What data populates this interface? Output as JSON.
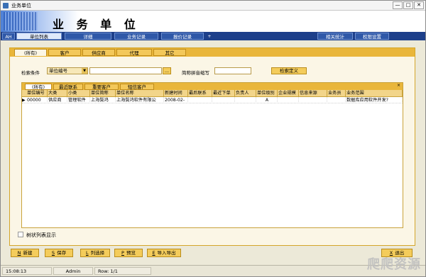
{
  "window": {
    "title": "业务单位",
    "minimize": "—",
    "maximize": "□",
    "close": "✕"
  },
  "banner": {
    "title": "业 务 单 位"
  },
  "main_tabs": [
    {
      "label": "AH"
    },
    {
      "label": "单位列表"
    },
    {
      "label": "详细"
    },
    {
      "label": "业务记录"
    },
    {
      "label": "报价记录"
    },
    {
      "label": "+"
    },
    {
      "label": "相关统计"
    },
    {
      "label": "权限设置"
    }
  ],
  "category_tabs": [
    {
      "label": "(所有)"
    },
    {
      "label": "客户"
    },
    {
      "label": "供应商"
    },
    {
      "label": "代理"
    },
    {
      "label": "其它"
    }
  ],
  "search": {
    "condition_label": "检索条件",
    "field_value": "单位编号",
    "input_value": "",
    "browse_label": "...",
    "pinyin_label": "简称拼音缩写",
    "pinyin_value": "",
    "custom_label": "检索定义"
  },
  "sub_tabs": [
    {
      "label": "(所有)"
    },
    {
      "label": "最近联系"
    },
    {
      "label": "重要客户"
    },
    {
      "label": "短信客户"
    }
  ],
  "sub_tabs_close": "×",
  "grid": {
    "columns": [
      "单位编号",
      "大类",
      "小类",
      "单位简称",
      "单位名称",
      "新建时间",
      "最后联系",
      "最近下单",
      "负责人",
      "单位级别",
      "企业规模",
      "信息来源",
      "业务员",
      "业务范围"
    ],
    "rows": [
      [
        "00000",
        "供应商",
        "管理软件",
        "上海鬓鸿",
        "上海鬓鸿软件有限公",
        "2008-02-",
        "",
        "",
        "",
        "A",
        "",
        "",
        "",
        "数据库应用软件开发?"
      ]
    ],
    "row_indicator": "▶"
  },
  "tree_toggle": {
    "label": "树状列表显示",
    "checked": false
  },
  "actions": [
    {
      "key": "N",
      "label": "新建"
    },
    {
      "key": "S",
      "label": "保存"
    },
    {
      "key": "L",
      "label": "列选择"
    },
    {
      "key": "P",
      "label": "预览"
    },
    {
      "key": "E",
      "label": "导入导出"
    }
  ],
  "exit_button": {
    "key": "X",
    "label": "退出"
  },
  "status": {
    "time": "15:08:13",
    "user": "Admin",
    "row": "Row: 1/1"
  },
  "watermark": "爬爬资源"
}
